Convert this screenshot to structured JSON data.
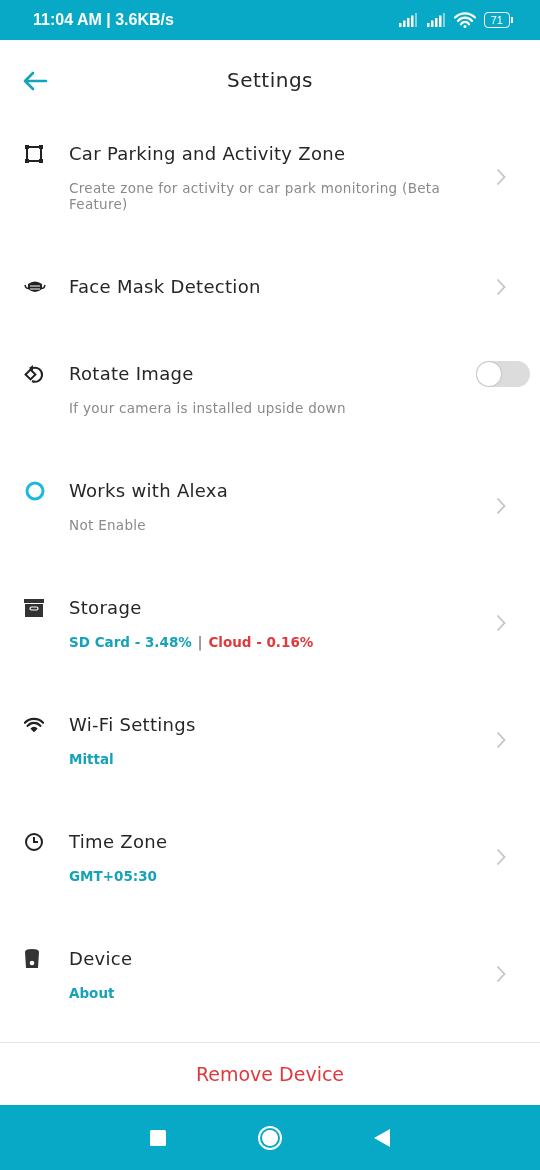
{
  "status_bar": {
    "time": "11:04 AM | 3.6KB/s",
    "battery": "71"
  },
  "header": {
    "title": "Settings"
  },
  "items": [
    {
      "kind": "link",
      "title": "Car Parking and Activity Zone",
      "subtitle": [
        {
          "text": "Create zone for activity or car park monitoring (Beta Feature)",
          "kind": "muted"
        }
      ]
    },
    {
      "kind": "link",
      "title": "Face Mask Detection"
    },
    {
      "kind": "toggle",
      "on": false,
      "title": "Rotate Image",
      "subtitle": [
        {
          "text": "If your camera is installed upside down",
          "kind": "muted"
        }
      ]
    },
    {
      "kind": "link",
      "title": "Works with Alexa",
      "subtitle": [
        {
          "text": "Not Enable",
          "kind": "muted"
        }
      ]
    },
    {
      "kind": "link",
      "title": "Storage",
      "subtitle": [
        {
          "text": "SD Card - 3.48%",
          "kind": "accent"
        },
        {
          "text": "|",
          "kind": "plain"
        },
        {
          "text": "Cloud - 0.16%",
          "kind": "alert"
        }
      ]
    },
    {
      "kind": "link",
      "title": "Wi-Fi Settings",
      "subtitle": [
        {
          "text": "Mittal",
          "kind": "accent"
        }
      ]
    },
    {
      "kind": "link",
      "title": "Time Zone",
      "subtitle": [
        {
          "text": "GMT+05:30",
          "kind": "accent"
        }
      ]
    },
    {
      "kind": "link",
      "title": "Device",
      "subtitle": [
        {
          "text": "About",
          "kind": "accent"
        }
      ]
    }
  ],
  "footer": {
    "action": "Remove Device"
  }
}
